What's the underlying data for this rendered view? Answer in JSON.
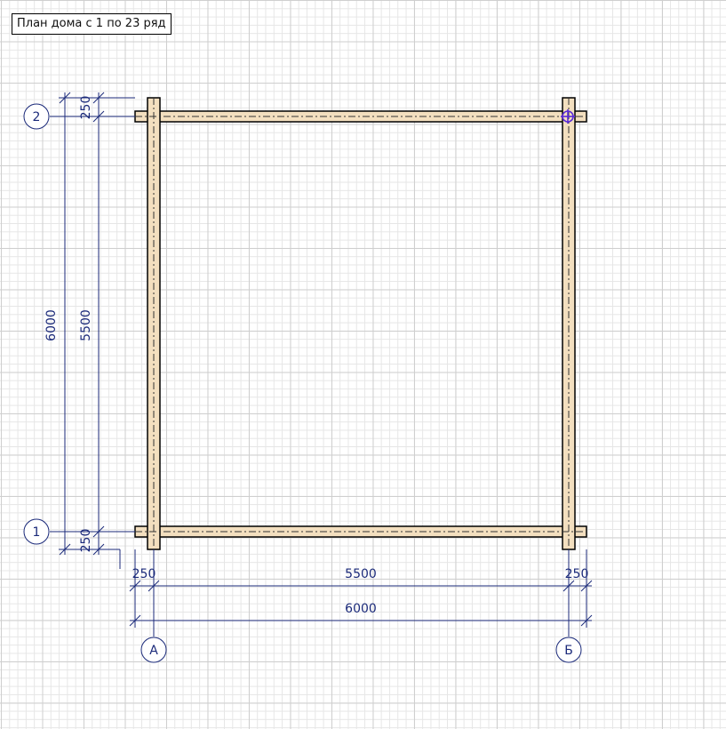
{
  "title": "План дома с 1 по 23 ряд",
  "axes": {
    "rows": [
      {
        "id": "row-1",
        "label": "1"
      },
      {
        "id": "row-2",
        "label": "2"
      }
    ],
    "cols": [
      {
        "id": "col-a",
        "label": "А"
      },
      {
        "id": "col-b",
        "label": "Б"
      }
    ]
  },
  "dimensions": {
    "left_outer_total": "6000",
    "left_inner": "5500",
    "left_top_offset": "250",
    "left_bottom_offset": "250",
    "bottom_left_offset": "250",
    "bottom_inner": "5500",
    "bottom_right_offset": "250",
    "bottom_outer_total": "6000"
  },
  "colors": {
    "wall_fill": "#f3dfbf",
    "wall_stroke": "#000000",
    "dimension": "#1b2a7a",
    "marker": "#5a2bd8"
  }
}
